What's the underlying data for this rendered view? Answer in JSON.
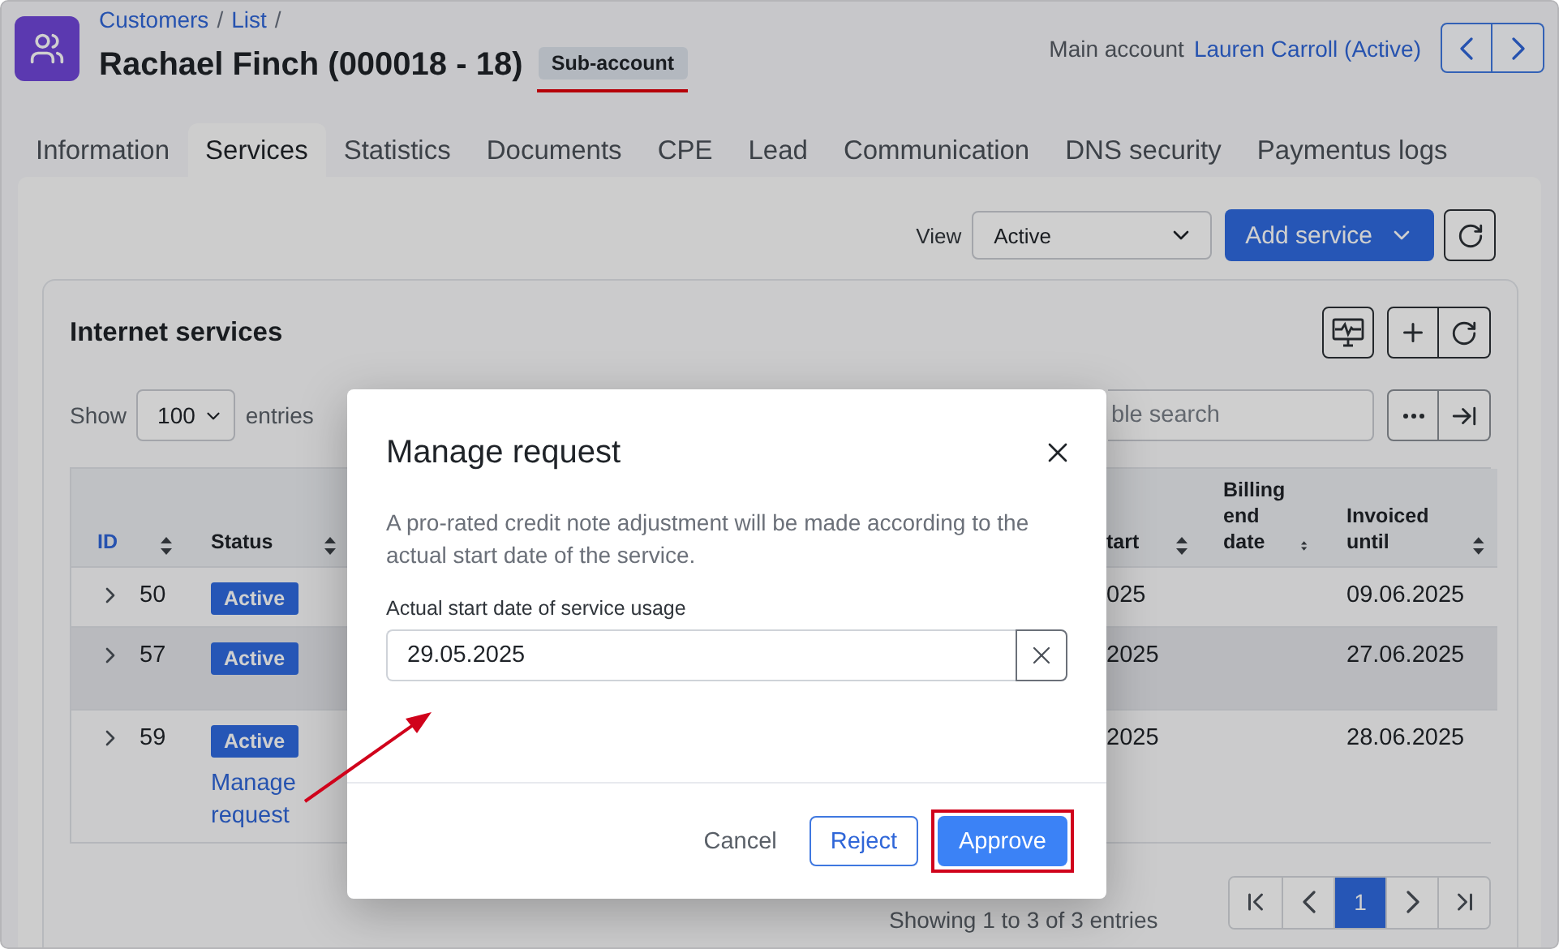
{
  "breadcrumb": {
    "items": [
      "Customers",
      "List"
    ],
    "separator": "/"
  },
  "title": "Rachael Finch (000018 - 18)",
  "badge": "Sub-account",
  "main_account": {
    "label": "Main account",
    "link": "Lauren Carroll (Active)"
  },
  "tabs": [
    {
      "label": "Information",
      "selected": false
    },
    {
      "label": "Services",
      "selected": true
    },
    {
      "label": "Statistics",
      "selected": false
    },
    {
      "label": "Documents",
      "selected": false
    },
    {
      "label": "CPE",
      "selected": false
    },
    {
      "label": "Lead",
      "selected": false
    },
    {
      "label": "Communication",
      "selected": false
    },
    {
      "label": "DNS security",
      "selected": false
    },
    {
      "label": "Paymentus logs",
      "selected": false
    }
  ],
  "toolbar": {
    "view_label": "View",
    "view_value": "Active",
    "add_button": "Add service"
  },
  "card": {
    "title": "Internet services",
    "show_label": "Show",
    "page_size": "100",
    "entries_label": "entries",
    "search_placeholder": "ble search",
    "columns": [
      {
        "label": "ID",
        "sorted": true
      },
      {
        "label": "Status",
        "sorted": false
      },
      {
        "label": "tart",
        "sorted": false
      },
      {
        "label": "Billing end date",
        "sorted": false
      },
      {
        "label": "Invoiced until",
        "sorted": false
      }
    ],
    "rows": [
      {
        "id": "50",
        "status": "Active",
        "expanded": false,
        "hovered": false,
        "column_3": "025",
        "invoiced_until": "09.06.2025"
      },
      {
        "id": "57",
        "status": "Active",
        "expanded": false,
        "hovered": true,
        "column_3": "2025",
        "invoiced_until": "27.06.2025"
      },
      {
        "id": "59",
        "status": "Active",
        "expanded": false,
        "hovered": false,
        "action": "Manage request",
        "column_3": "2025",
        "invoiced_until": "28.06.2025"
      }
    ],
    "footer": "Showing 1 to 3 of 3 entries",
    "pages": [
      {
        "label": "1",
        "selected": true
      }
    ]
  },
  "modal": {
    "title": "Manage request",
    "description": "A pro-rated credit note adjustment will be made according to the actual start date of the service.",
    "field_label": "Actual start date of service usage",
    "field_value": "29.05.2025",
    "buttons": [
      {
        "label": "Cancel",
        "kind": "text"
      },
      {
        "label": "Reject",
        "kind": "outline"
      },
      {
        "label": "Approve",
        "kind": "primary",
        "highlighted": true
      }
    ]
  }
}
